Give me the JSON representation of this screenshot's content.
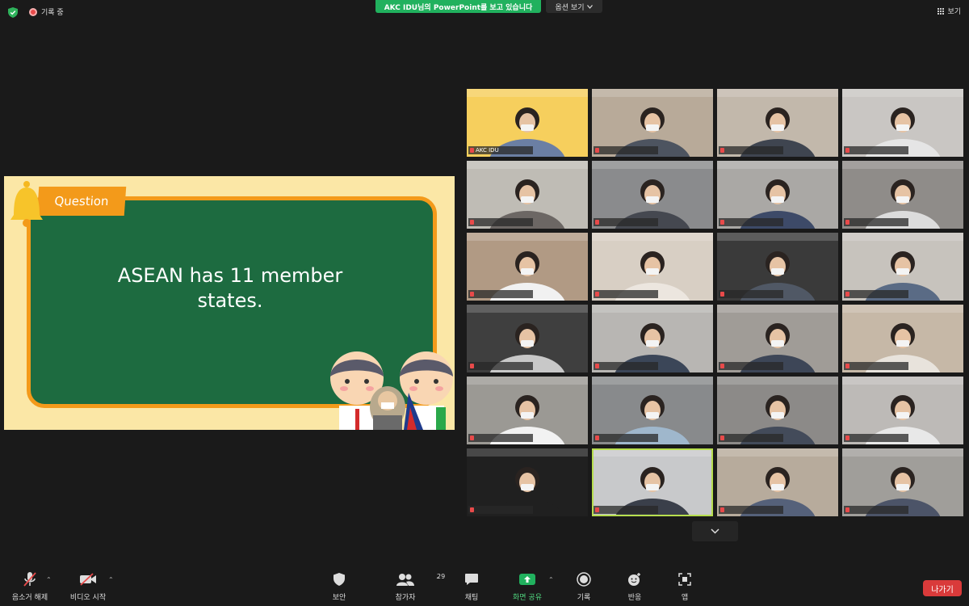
{
  "top_bar": {
    "recording_label": "기록 중",
    "share_banner": "AKC IDU님의 PowerPoint를 보고 있습니다",
    "view_options": "옵션 보기",
    "view_mode": "보기",
    "colors": {
      "share_banner": "#21b15e",
      "recording": "#e84a4a"
    }
  },
  "slide": {
    "question_label": "Question",
    "text_line1": "ASEAN has 11 member",
    "text_line2": "states.",
    "colors": {
      "board": "#1d6b40",
      "frame": "#f39a1a",
      "background": "#fbe7a6"
    }
  },
  "tiles": [
    {
      "name": "AKC IDU",
      "active": false,
      "bg": "#f6cf5d",
      "shirt": "#6b7fa4"
    },
    {
      "name": "",
      "active": false,
      "bg": "#b8aa99",
      "shirt": "#4d5460"
    },
    {
      "name": "",
      "active": false,
      "bg": "#c2b8ab",
      "shirt": "#3f4550"
    },
    {
      "name": "",
      "active": false,
      "bg": "#c9c6c3",
      "shirt": "#e5e5e5"
    },
    {
      "name": "",
      "active": false,
      "bg": "#bfbcb5",
      "shirt": "#6c6764"
    },
    {
      "name": "",
      "active": false,
      "bg": "#8a8b8d",
      "shirt": "#454850"
    },
    {
      "name": "",
      "active": false,
      "bg": "#aaa8a5",
      "shirt": "#3d4a68"
    },
    {
      "name": "",
      "active": false,
      "bg": "#8f8c89",
      "shirt": "#dcdcdc"
    },
    {
      "name": "",
      "active": false,
      "bg": "#b19a84",
      "shirt": "#f1f1f1"
    },
    {
      "name": "",
      "active": false,
      "bg": "#d8cfc4",
      "shirt": "#ece6df"
    },
    {
      "name": "",
      "active": false,
      "bg": "#3a3a3a",
      "shirt": "#505865"
    },
    {
      "name": "",
      "active": false,
      "bg": "#c7c3bd",
      "shirt": "#5a6b85"
    },
    {
      "name": "",
      "active": false,
      "bg": "#3f3f3f",
      "shirt": "#c8c8c8"
    },
    {
      "name": "",
      "active": false,
      "bg": "#b8b6b3",
      "shirt": "#3b4658"
    },
    {
      "name": "",
      "active": false,
      "bg": "#a09c97",
      "shirt": "#3d4657"
    },
    {
      "name": "",
      "active": false,
      "bg": "#c6b8a7",
      "shirt": "#e8e3dc"
    },
    {
      "name": "",
      "active": false,
      "bg": "#9b9994",
      "shirt": "#f2f2f2"
    },
    {
      "name": "",
      "active": false,
      "bg": "#888a8c",
      "shirt": "#9fb7cc"
    },
    {
      "name": "",
      "active": false,
      "bg": "#8c8a88",
      "shirt": "#434b5a"
    },
    {
      "name": "",
      "active": false,
      "bg": "#bdbab7",
      "shirt": "#e8e8e8"
    },
    {
      "name": "",
      "active": false,
      "bg": "#202020",
      "shirt": "#202020"
    },
    {
      "name": "",
      "active": true,
      "bg": "#c8c9cb",
      "shirt": "#3a3f4a"
    },
    {
      "name": "",
      "active": false,
      "bg": "#b7ab9c",
      "shirt": "#55617a"
    },
    {
      "name": "",
      "active": false,
      "bg": "#a09e9a",
      "shirt": "#4c5468"
    }
  ],
  "toolbar": {
    "unmute": "음소거 해제",
    "start_video": "비디오 시작",
    "security": "보안",
    "participants": "참가자",
    "participant_count": "29",
    "chat": "채팅",
    "share_screen": "화면 공유",
    "record": "기록",
    "reactions": "반응",
    "apps": "앱",
    "leave": "나가기"
  }
}
